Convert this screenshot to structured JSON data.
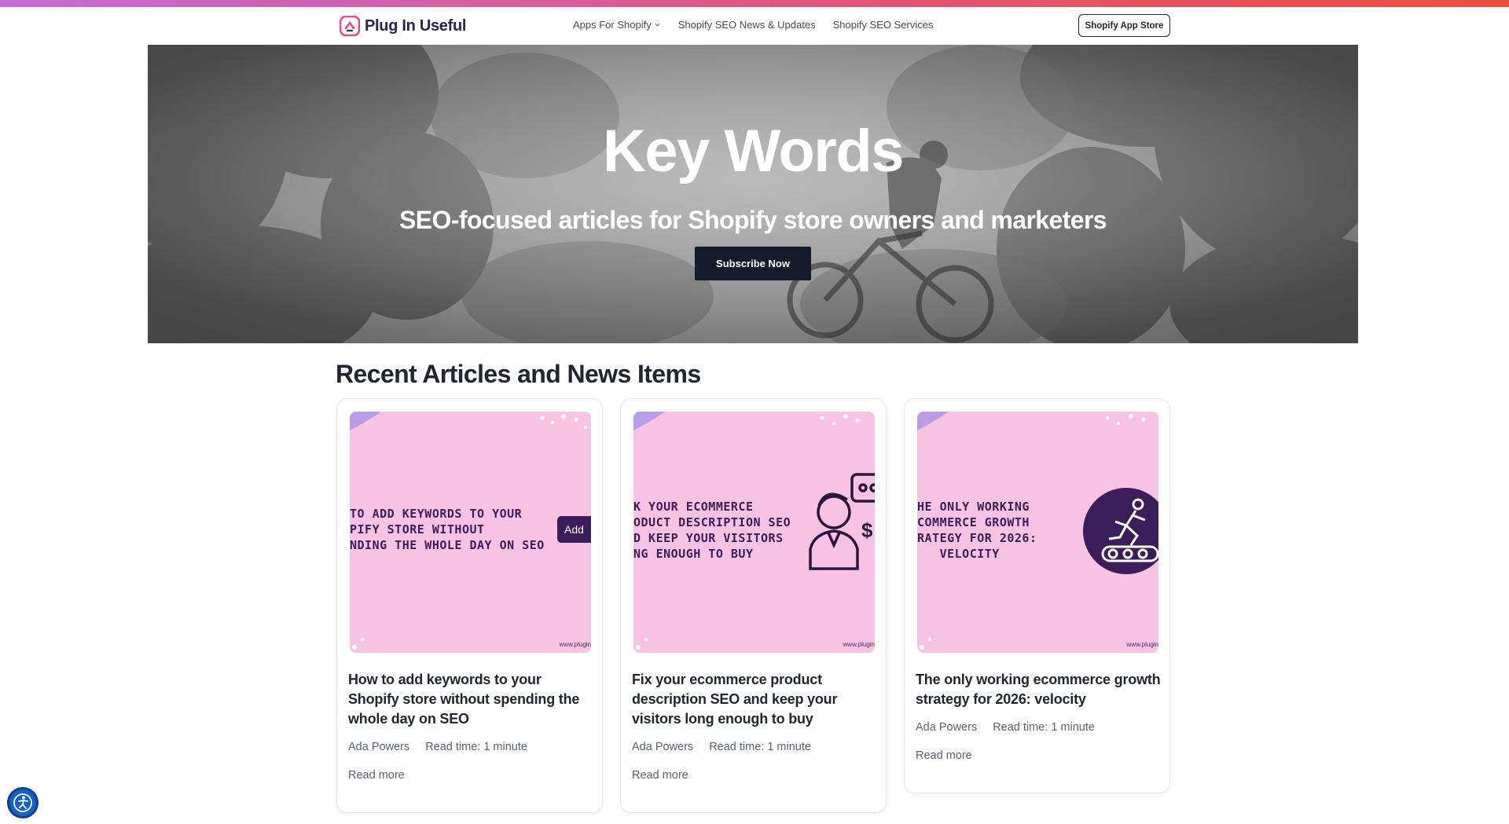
{
  "brand": {
    "name": "Plug In Useful",
    "accent": "#e0557a",
    "logo_icon": "plugin-logo-icon"
  },
  "nav": {
    "items": [
      {
        "label": "Apps For Shopify",
        "has_dropdown": true
      },
      {
        "label": "Shopify SEO News & Updates",
        "has_dropdown": false
      },
      {
        "label": "Shopify SEO Services",
        "has_dropdown": false
      }
    ],
    "cta_label": "Shopify App Store"
  },
  "hero": {
    "title": "Key Words",
    "subtitle": "SEO-focused articles for Shopify store owners and marketers",
    "button_label": "Subscribe Now"
  },
  "section": {
    "title": "Recent Articles and News Items"
  },
  "articles": [
    {
      "image_text": "TO ADD KEYWORDS TO YOUR\nPIFY STORE WITHOUT\nNDING THE WHOLE DAY ON SEO",
      "image_badge": "Add",
      "image_url": "www.plugin",
      "title": "How to add keywords to your Shopify store without spending the whole day on SEO",
      "author": "Ada Powers",
      "read_time": "Read time: 1 minute",
      "read_more": "Read more"
    },
    {
      "image_text": "K YOUR ECOMMERCE\nODUCT DESCRIPTION SEO\nD KEEP YOUR VISITORS\nNG ENOUGH TO BUY",
      "image_url": "www.plugin",
      "title": "Fix your ecommerce product description SEO and keep your visitors long enough to buy",
      "author": "Ada Powers",
      "read_time": "Read time: 1 minute",
      "read_more": "Read more"
    },
    {
      "image_text": "HE ONLY WORKING\nCOMMERCE GROWTH\nRATEGY FOR 2026:\n   VELOCITY",
      "image_url": "www.plugin",
      "title": "The only working ecommerce growth strategy for 2026: velocity",
      "author": "Ada Powers",
      "read_time": "Read time: 1 minute",
      "read_more": "Read more"
    }
  ],
  "accessibility": {
    "icon": "accessibility-icon"
  }
}
